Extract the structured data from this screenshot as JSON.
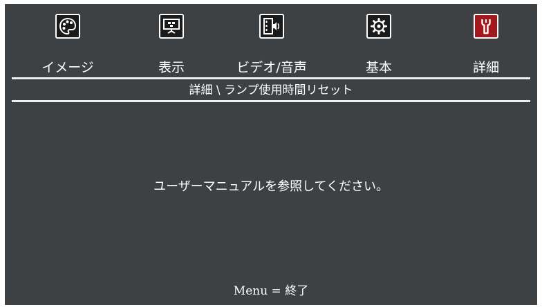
{
  "colors": {
    "background": "#3e4143",
    "text": "#ffffff",
    "active_tab": "#a3181c"
  },
  "tabs": [
    {
      "label": "イメージ",
      "icon": "palette-icon",
      "active": false
    },
    {
      "label": "表示",
      "icon": "display-icon",
      "active": false
    },
    {
      "label": "ビデオ/音声",
      "icon": "video-audio-icon",
      "active": false
    },
    {
      "label": "基本",
      "icon": "gear-icon",
      "active": false
    },
    {
      "label": "詳細",
      "icon": "wrench-icon",
      "active": true
    }
  ],
  "breadcrumb": "詳細 \\ ランプ使用時間リセット",
  "message": "ユーザーマニュアルを参照してください。",
  "footer": "Menu = 終了"
}
